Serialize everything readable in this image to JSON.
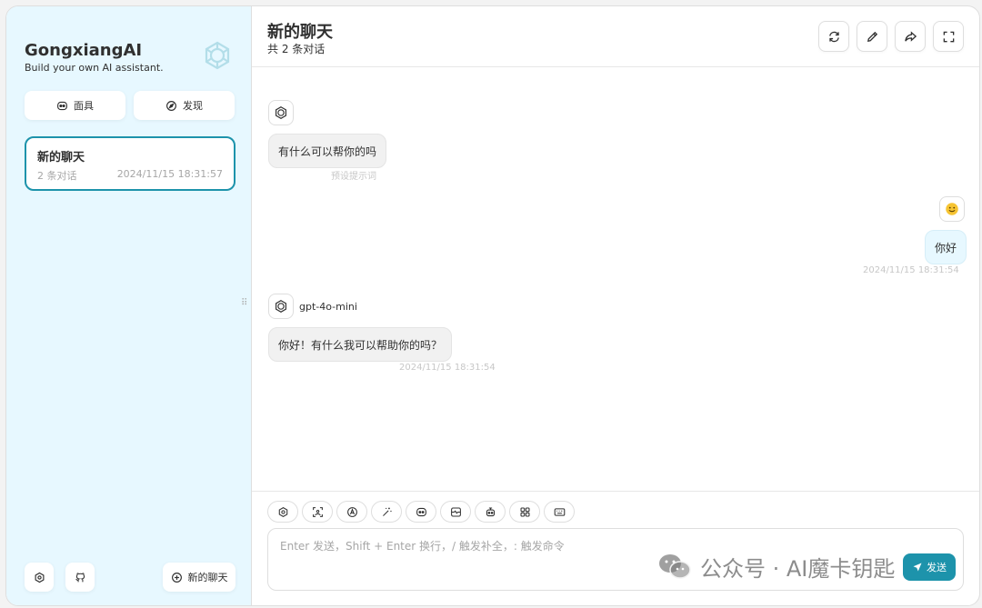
{
  "sidebar": {
    "brand_title": "GongxiangAI",
    "brand_subtitle": "Build your own AI assistant.",
    "mask_button": "面具",
    "discover_button": "发现",
    "chat_item": {
      "title": "新的聊天",
      "count": "2 条对话",
      "time": "2024/11/15 18:31:57"
    },
    "new_chat_button": "新的聊天"
  },
  "header": {
    "title": "新的聊天",
    "subtitle": "共 2 条对话"
  },
  "messages": {
    "m1": {
      "text": "有什么可以帮你的吗",
      "meta": "预设提示词"
    },
    "m2": {
      "text": "你好",
      "meta": "2024/11/15 18:31:54"
    },
    "m3": {
      "model": "gpt-4o-mini",
      "text": "你好！有什么我可以帮助你的吗？",
      "meta": "2024/11/15 18:31:54"
    }
  },
  "composer": {
    "placeholder": "Enter 发送，Shift + Enter 换行，/ 触发补全，: 触发命令",
    "send_label": "发送"
  },
  "watermark": {
    "text": "公众号 · AI魔卡钥匙"
  },
  "colors": {
    "accent": "#1d93ab",
    "sidebar_bg": "#e7f8ff"
  }
}
